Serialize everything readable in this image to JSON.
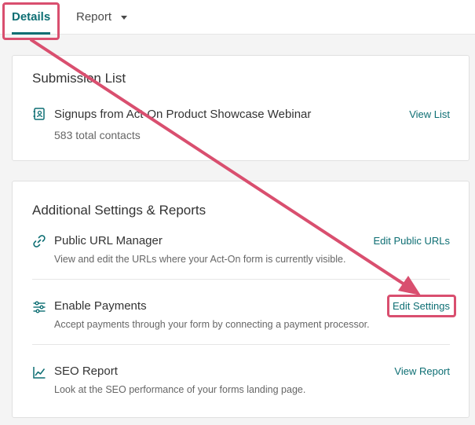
{
  "tabs": [
    {
      "label": "Details",
      "active": true
    },
    {
      "label": "Report",
      "has_dropdown": true
    }
  ],
  "submission_card": {
    "title": "Submission List",
    "item": {
      "icon": "contact-book-icon",
      "title": "Signups from Act-On Product Showcase Webinar",
      "count": "583 total contacts",
      "link": "View List"
    }
  },
  "settings_card": {
    "title": "Additional Settings & Reports",
    "items": [
      {
        "icon": "link-icon",
        "title": "Public URL Manager",
        "desc": "View and edit the URLs where your Act-On form is currently visible.",
        "link": "Edit Public URLs"
      },
      {
        "icon": "sliders-icon",
        "title": "Enable Payments",
        "desc": "Accept payments through your form by connecting a payment processor.",
        "link": "Edit Settings"
      },
      {
        "icon": "line-chart-icon",
        "title": "SEO Report",
        "desc": "Look at the SEO performance of your forms landing page.",
        "link": "View Report"
      }
    ]
  },
  "colors": {
    "accent": "#0d6e73",
    "annotation": "#d94f6f",
    "background": "#f4f4f4"
  }
}
